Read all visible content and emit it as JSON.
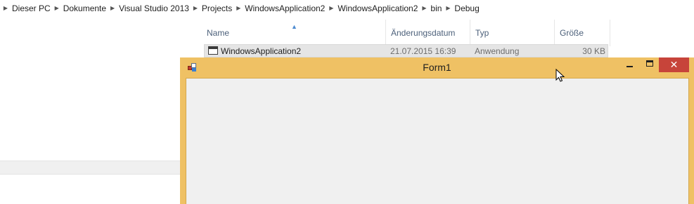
{
  "breadcrumb": {
    "items": [
      "Dieser PC",
      "Dokumente",
      "Visual Studio 2013",
      "Projects",
      "WindowsApplication2",
      "WindowsApplication2",
      "bin",
      "Debug"
    ],
    "separator_icon": "chevron-right-icon"
  },
  "filelist": {
    "columns": {
      "name": "Name",
      "date": "Änderungsdatum",
      "type": "Typ",
      "size": "Größe"
    },
    "sort_icon": "sort-ascending-icon",
    "rows": [
      {
        "name": "WindowsApplication2",
        "date": "21.07.2015 16:39",
        "type": "Anwendung",
        "size": "30 KB",
        "icon": "application-window-icon"
      }
    ]
  },
  "form": {
    "title": "Form1",
    "title_bar_color": "#efc164",
    "close_color": "#c7443a",
    "controls": {
      "minimize": "minimize-icon",
      "maximize": "maximize-icon",
      "close": "close-icon"
    },
    "close_glyph": "✕"
  }
}
